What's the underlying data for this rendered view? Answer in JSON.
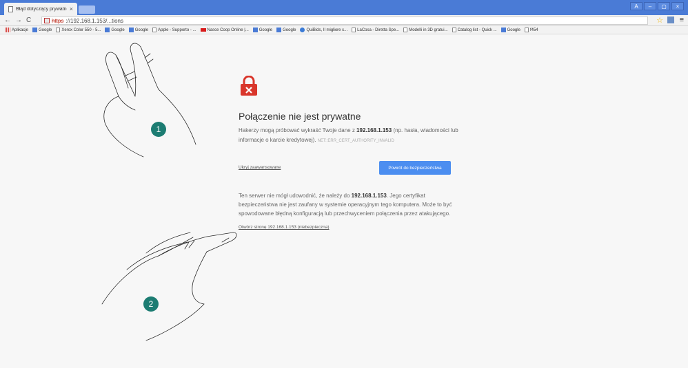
{
  "browser": {
    "tab_title": "Błąd dotyczący prywatnoś",
    "tab_close": "×",
    "window_buttons": [
      "A",
      "–",
      "▢",
      "×"
    ],
    "nav": {
      "back": "←",
      "forward": "→",
      "reload": "C"
    },
    "address": {
      "scheme": "https",
      "rest": "://192.168.1.153/...tions"
    },
    "star": "☆",
    "menu": "≡"
  },
  "bookmarks": [
    {
      "icon": "apps",
      "label": "Aplikacje"
    },
    {
      "icon": "google",
      "label": "Google"
    },
    {
      "icon": "page",
      "label": "Xerox Color 550 - 5..."
    },
    {
      "icon": "google",
      "label": "Google"
    },
    {
      "icon": "google",
      "label": "Google"
    },
    {
      "icon": "page",
      "label": "Apple - Supporto - ..."
    },
    {
      "icon": "nasce",
      "label": "Nasce Coop Online |..."
    },
    {
      "icon": "google",
      "label": "Google"
    },
    {
      "icon": "google",
      "label": "Google"
    },
    {
      "icon": "quibids",
      "label": "QuiBids, Il migliore s..."
    },
    {
      "icon": "page",
      "label": "LaCosa - Diretta Spe..."
    },
    {
      "icon": "page",
      "label": "Modelli in 3D gratui..."
    },
    {
      "icon": "page",
      "label": "Catalog list - Quick ..."
    },
    {
      "icon": "google",
      "label": "Google"
    },
    {
      "icon": "page",
      "label": "f454"
    }
  ],
  "warning": {
    "heading": "Połączenie nie jest prywatne",
    "p1_before": "Hakerzy mogą próbować wykraść Twoje dane z ",
    "host": "192.168.1.153",
    "p1_after": " (np. hasła, wiadomości lub informacje o karcie kredytowej).",
    "error_code": "NET::ERR_CERT_AUTHORITY_INVALID",
    "hide_advanced": "Ukryj zaawansowane",
    "back_button": "Powrót do bezpieczeństwa",
    "p2_before": "Ten serwer nie mógł udowodnić, że należy do ",
    "p2_after": ". Jego certyfikat bezpieczeństwa nie jest zaufany w systemie operacyjnym tego komputera. Może to być spowodowane błędną konfiguracją lub przechwyceniem połączenia przez atakującego.",
    "proceed_link": "Otwórz stronę 192.168.1.153 (niebezpieczna)"
  },
  "colors": {
    "accent": "#4c8ef0",
    "badge": "#1c7c72",
    "lock": "#d9362b",
    "chrome": "#4a7bd6"
  },
  "annotations": {
    "badge1": "1",
    "badge2": "2"
  }
}
